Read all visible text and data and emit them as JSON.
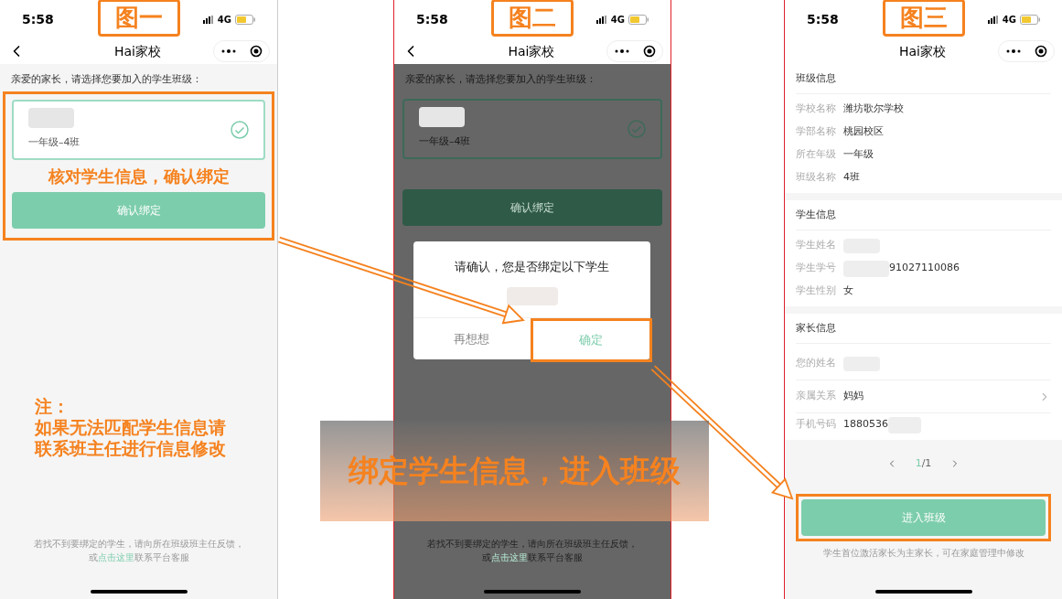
{
  "screen_1": {
    "label": "图一",
    "time": "5:58",
    "network": "4G",
    "back_button": true,
    "title": "Hai家校",
    "prompt": "亲爱的家长，请选择您要加入的学生班级：",
    "class_option": {
      "class_name": "一年级–4班",
      "selected": true
    },
    "callout": "核对学生信息，确认绑定",
    "confirm_button": "确认绑定",
    "note": [
      "注：",
      "如果无法匹配学生信息请",
      "联系班主任进行信息修改"
    ],
    "footer": {
      "line_1": "若找不到要绑定的学生，请向所在班级班主任反馈，",
      "line_2_before": "或",
      "link": "点击这里",
      "line_2_after": "联系平台客服"
    }
  },
  "screen_2": {
    "label": "图二",
    "time": "5:58",
    "network": "4G",
    "back_button": true,
    "title": "Hai家校",
    "prompt": "亲爱的家长，请选择您要加入的学生班级：",
    "class_option": {
      "class_name": "一年级–4班",
      "selected": true
    },
    "confirm_button": "确认绑定",
    "dimmed": true,
    "dialog": {
      "message": "请确认，您是否绑定以下学生",
      "cancel": "再想想",
      "ok": "确定"
    },
    "footer": {
      "line_1": "若找不到要绑定的学生，请向所在班级班主任反馈，",
      "line_2_before": "或",
      "link": "点击这里",
      "line_2_after": "联系平台客服"
    }
  },
  "screen_3": {
    "label": "图三",
    "time": "5:58",
    "network": "4G",
    "back_button": false,
    "title": "Hai家校",
    "sections": [
      {
        "title": "班级信息",
        "rows": [
          {
            "label": "学校名称",
            "value": "潍坊歌尔学校",
            "kind": "plain"
          },
          {
            "label": "学部名称",
            "value": "桃园校区",
            "kind": "plain"
          },
          {
            "label": "所在年级",
            "value": "一年级",
            "kind": "plain"
          },
          {
            "label": "班级名称",
            "value": "4班",
            "kind": "plain"
          }
        ]
      },
      {
        "title": "学生信息",
        "rows": [
          {
            "label": "学生姓名",
            "kind": "hidden"
          },
          {
            "label": "学生学号",
            "value": "91027110086",
            "kind": "hidden_before"
          },
          {
            "label": "学生性别",
            "value": "女",
            "kind": "plain"
          }
        ]
      },
      {
        "title": "家长信息",
        "rows": [
          {
            "label": "您的姓名",
            "kind": "hidden"
          },
          {
            "label": "亲属关系",
            "value": "妈妈",
            "kind": "select"
          },
          {
            "label": "手机号码",
            "value": "1880536",
            "kind": "hidden_after"
          }
        ]
      }
    ],
    "pager": {
      "current": "1",
      "total": "/1"
    },
    "enter_button": "进入班级",
    "note": "学生首位激活家长为主家长，可在家庭管理中修改"
  },
  "banner": "绑定学生信息，进入班级"
}
